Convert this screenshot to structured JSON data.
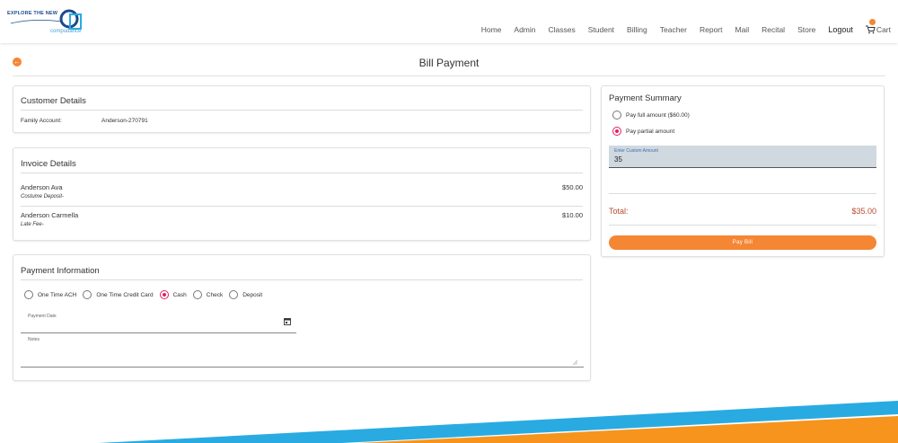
{
  "header": {
    "logo_tagline": "EXPLORE THE NEW",
    "logo_brand": "compudance",
    "nav": [
      "Home",
      "Admin",
      "Classes",
      "Student",
      "Billing",
      "Teacher",
      "Report",
      "Mail",
      "Recital",
      "Store"
    ],
    "logout": "Logout",
    "cart": "Cart"
  },
  "page": {
    "title": "Bill Payment"
  },
  "customer": {
    "title": "Customer Details",
    "family_label": "Family Account:",
    "family_value": "Anderson-270791"
  },
  "invoice": {
    "title": "Invoice Details",
    "items": [
      {
        "name": "Anderson Ava",
        "desc": "Costume Deposit-",
        "amount": "$50.00"
      },
      {
        "name": "Anderson Carmella",
        "desc": "Late Fee-",
        "amount": "$10.00"
      }
    ]
  },
  "payment_info": {
    "title": "Payment Information",
    "methods": [
      "One Time ACH",
      "One Time Credit Card",
      "Cash",
      "Check",
      "Deposit"
    ],
    "selected_method": "Cash",
    "date_label": "Payment Date",
    "date_value": "",
    "notes_label": "Notes",
    "notes_value": ""
  },
  "summary": {
    "title": "Payment Summary",
    "options": [
      "Pay full amount ($60.00)",
      "Pay partial amount"
    ],
    "selected_option": "Pay partial amount",
    "custom_label": "Enter Custom Amount",
    "custom_value": "35",
    "total_label": "Total:",
    "total_value": "$35.00",
    "pay_button": "Pay Bill"
  },
  "colors": {
    "accent": "#f58634",
    "radio_checked": "#e91e63",
    "total_text": "#b64a2d",
    "footer_blue": "#29abe2",
    "footer_orange": "#f7941d"
  }
}
